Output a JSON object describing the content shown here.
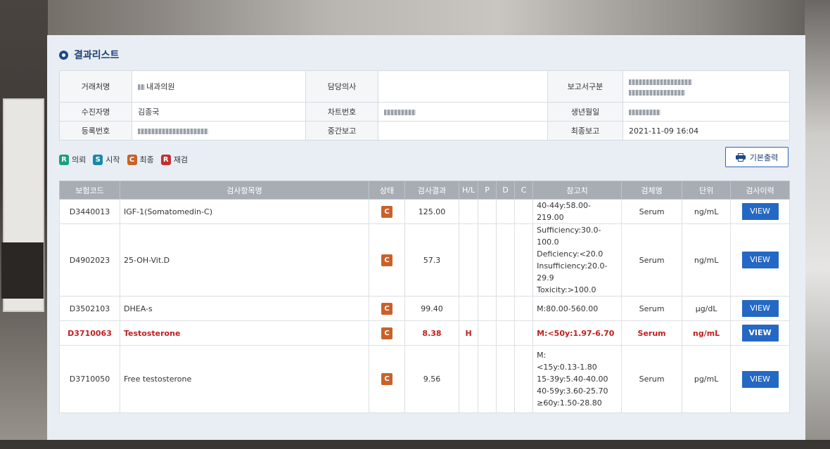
{
  "page": {
    "title": "결과리스트"
  },
  "info": {
    "client_label": "거래처명",
    "client_value": "내과의원",
    "doctor_label": "담당의사",
    "doctor_value": "",
    "report_type_label": "보고서구분",
    "recipient_label": "수진자명",
    "recipient_value": "김종국",
    "chart_no_label": "차트번호",
    "birth_label": "생년월일",
    "reg_no_label": "등록번호",
    "interim_label": "중간보고",
    "interim_value": "",
    "final_label": "최종보고",
    "final_value": "2021-11-09 16:04"
  },
  "legend": [
    {
      "code": "R",
      "label": "의뢰"
    },
    {
      "code": "S",
      "label": "시작"
    },
    {
      "code": "C",
      "label": "최종"
    },
    {
      "code": "R",
      "label": "재검"
    }
  ],
  "print_button": "기본출력",
  "columns": [
    "보험코드",
    "검사항목명",
    "상태",
    "검사결과",
    "H/L",
    "P",
    "D",
    "C",
    "참고치",
    "검체명",
    "단위",
    "검사이력"
  ],
  "rows": [
    {
      "code": "D3440013",
      "name": "IGF-1(Somatomedin-C)",
      "status": "C",
      "result": "125.00",
      "hl": "",
      "p": "",
      "d": "",
      "c": "",
      "ref": [
        "40-44y:58.00-219.00"
      ],
      "specimen": "Serum",
      "unit": "ng/mL",
      "history": "VIEW"
    },
    {
      "code": "D4902023",
      "name": "25-OH-Vit.D",
      "status": "C",
      "result": "57.3",
      "hl": "",
      "p": "",
      "d": "",
      "c": "",
      "ref": [
        "Sufficiency:30.0-100.0",
        "Deficiency:<20.0",
        "Insufficiency:20.0-29.9",
        "Toxicity:>100.0"
      ],
      "specimen": "Serum",
      "unit": "ng/mL",
      "history": "VIEW"
    },
    {
      "code": "D3502103",
      "name": "DHEA-s",
      "status": "C",
      "result": "99.40",
      "hl": "",
      "p": "",
      "d": "",
      "c": "",
      "ref": [
        "M:80.00-560.00"
      ],
      "specimen": "Serum",
      "unit": "μg/dL",
      "history": "VIEW"
    },
    {
      "code": "D3710063",
      "name": "Testosterone",
      "status": "C",
      "result": "8.38",
      "hl": "H",
      "p": "",
      "d": "",
      "c": "",
      "ref": [
        "M:<50y:1.97-6.70"
      ],
      "specimen": "Serum",
      "unit": "ng/mL",
      "history": "VIEW"
    },
    {
      "code": "D3710050",
      "name": "Free testosterone",
      "status": "C",
      "result": "9.56",
      "hl": "",
      "p": "",
      "d": "",
      "c": "",
      "ref": [
        "M:",
        "<15y:0.13-1.80",
        "15-39y:5.40-40.00",
        "40-59y:3.60-25.70",
        "≥60y:1.50-28.80"
      ],
      "specimen": "Serum",
      "unit": "pg/mL",
      "history": "VIEW"
    }
  ]
}
